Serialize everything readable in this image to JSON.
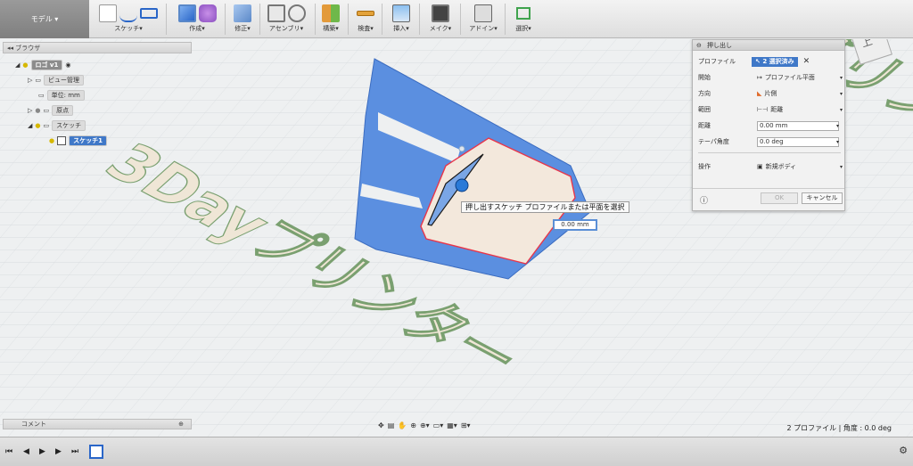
{
  "toolbar": {
    "mode": "モデル",
    "groups": [
      {
        "label": "スケッチ",
        "caret": "▾"
      },
      {
        "label": "作成",
        "caret": "▾"
      },
      {
        "label": "修正",
        "caret": "▾"
      },
      {
        "label": "アセンブリ",
        "caret": "▾"
      },
      {
        "label": "構築",
        "caret": "▾"
      },
      {
        "label": "検査",
        "caret": "▾"
      },
      {
        "label": "挿入",
        "caret": "▾"
      },
      {
        "label": "メイク",
        "caret": "▾"
      },
      {
        "label": "アドイン",
        "caret": "▾"
      },
      {
        "label": "選択",
        "caret": "▾"
      }
    ]
  },
  "browser": {
    "title": "ブラウザ",
    "items": [
      {
        "label": "ロゴ v1"
      },
      {
        "label": "ビュー管理"
      },
      {
        "label": "単位: mm"
      },
      {
        "label": "原点"
      },
      {
        "label": "スケッチ"
      },
      {
        "label": "スケッチ1"
      }
    ]
  },
  "comment": {
    "title": "コメント"
  },
  "viewcube": {
    "face": "上"
  },
  "viewport": {
    "text_3d": "3Dayプリンター",
    "tooltip": "押し出すスケッチ プロファイルまたは平面を選択",
    "dimension": "0.00 mm",
    "shape_color": "#5b8fe0"
  },
  "dialog": {
    "title": "押し出し",
    "rows": [
      {
        "key": "プロファイル",
        "value": "2 選択済み"
      },
      {
        "key": "開始",
        "value": "プロファイル平面"
      },
      {
        "key": "方向",
        "value": "片側"
      },
      {
        "key": "範囲",
        "value": "距離"
      },
      {
        "key": "距離",
        "value": "0.00 mm"
      },
      {
        "key": "テーパ角度",
        "value": "0.0 deg"
      },
      {
        "key": "操作",
        "value": "新規ボディ"
      }
    ],
    "ok": "OK",
    "cancel": "キャンセル"
  },
  "status": "2 プロファイル | 角度 : 0.0 deg"
}
